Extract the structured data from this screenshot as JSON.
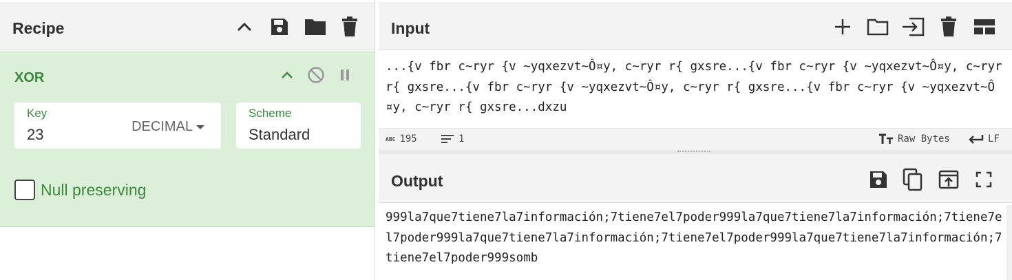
{
  "recipe": {
    "title": "Recipe",
    "icons": [
      "chevron-up-icon",
      "save-icon",
      "folder-icon",
      "trash-icon"
    ]
  },
  "operation": {
    "name": "XOR",
    "key_label": "Key",
    "key_value": "23",
    "key_format": "DECIMAL",
    "scheme_label": "Scheme",
    "scheme_value": "Standard",
    "null_preserving_label": "Null preserving",
    "null_preserving_checked": false
  },
  "input": {
    "title": "Input",
    "text": "...{v fbr c~ryr {v ~yqxezvt~Ô¤y, c~ryr r{ gxsre...{v fbr c~ryr {v ~yqxezvt~Ô¤y, c~ryr r{ gxsre...{v fbr c~ryr {v ~yqxezvt~Ô¤y, c~ryr r{ gxsre...{v fbr c~ryr {v ~yqxezvt~Ô¤y, c~ryr r{ gxsre...dxzu",
    "char_count_label": "ABC",
    "char_count": "195",
    "line_count": "1",
    "encoding": "Raw Bytes",
    "eol": "LF"
  },
  "output": {
    "title": "Output",
    "text": "999la7que7tiene7la7información;7tiene7el7poder999la7que7tiene7la7información;7tiene7el7poder999la7que7tiene7la7información;7tiene7el7poder999la7que7tiene7la7información;7tiene7el7poder999somb"
  },
  "colors": {
    "accent_green": "#3b8a3b",
    "operation_bg": "#dcefd9",
    "header_bg": "#f3f3f3"
  }
}
